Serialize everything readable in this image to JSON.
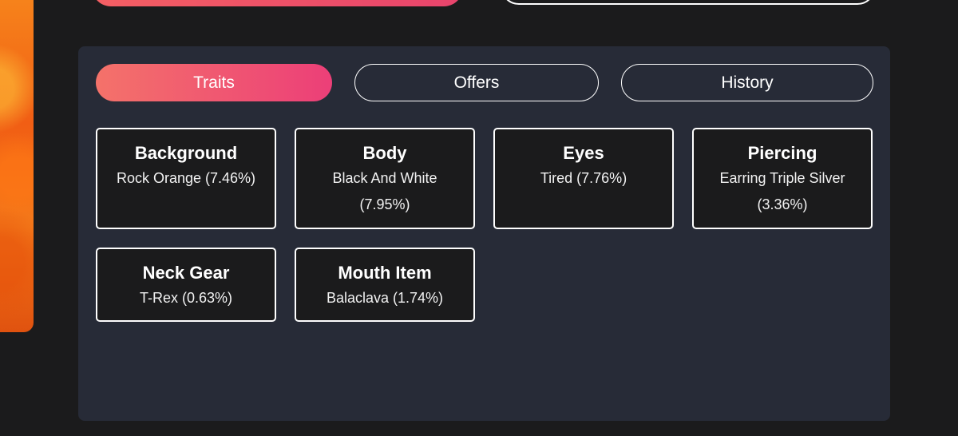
{
  "tabs": [
    {
      "label": "Traits",
      "active": true
    },
    {
      "label": "Offers",
      "active": false
    },
    {
      "label": "History",
      "active": false
    }
  ],
  "traits": [
    {
      "name": "Background",
      "value": "Rock Orange (7.46%)"
    },
    {
      "name": "Body",
      "value": "Black And White (7.95%)"
    },
    {
      "name": "Eyes",
      "value": "Tired (7.76%)"
    },
    {
      "name": "Piercing",
      "value": "Earring Triple Silver (3.36%)"
    },
    {
      "name": "Neck Gear",
      "value": "T-Rex (0.63%)"
    },
    {
      "name": "Mouth Item",
      "value": "Balaclava (1.74%)"
    }
  ],
  "colors": {
    "page_background": "#1b1b1c",
    "panel_background": "#272b37",
    "accent_gradient_start": "#f4726a",
    "accent_gradient_end": "#ec3f78",
    "artwork_orange": "#f15e14"
  }
}
